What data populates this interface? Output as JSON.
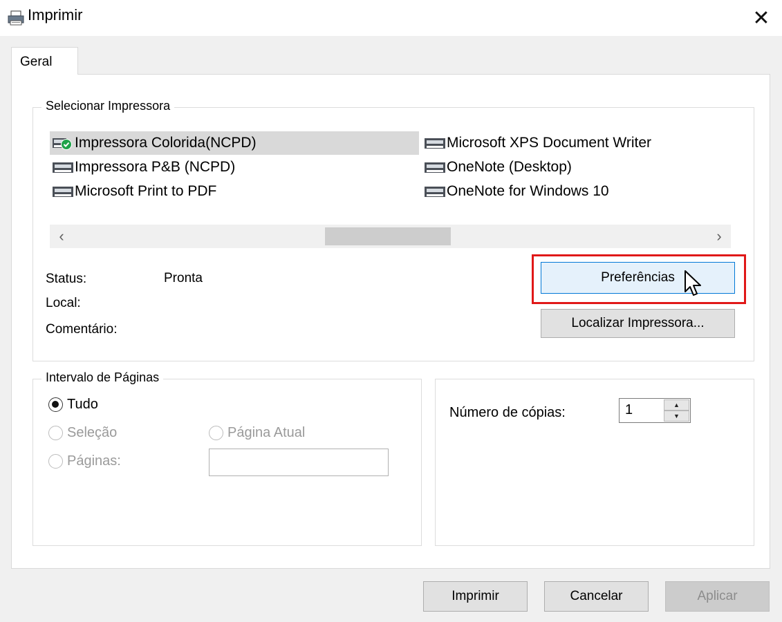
{
  "window": {
    "title": "Imprimir",
    "close_glyph": "✕"
  },
  "tabs": [
    {
      "label": "Geral"
    }
  ],
  "select_printer": {
    "legend": "Selecionar Impressora",
    "printers": [
      {
        "label": "Impressora Colorida(NCPD)",
        "selected": true,
        "default": true
      },
      {
        "label": "Impressora P&B (NCPD)"
      },
      {
        "label": "Microsoft Print to PDF"
      },
      {
        "label": "Microsoft XPS Document Writer"
      },
      {
        "label": "OneNote (Desktop)"
      },
      {
        "label": "OneNote for Windows 10"
      }
    ],
    "scroll_left": "‹",
    "scroll_right": "›",
    "status_label": "Status:",
    "status_value": "Pronta",
    "local_label": "Local:",
    "comment_label": "Comentário:",
    "preferences_button": "Preferências",
    "find_printer_button": "Localizar Impressora..."
  },
  "page_range": {
    "legend": "Intervalo de Páginas",
    "all": "Tudo",
    "selection": "Seleção",
    "current_page": "Página Atual",
    "pages": "Páginas:",
    "selected_option": "Tudo"
  },
  "copies": {
    "label": "Número de cópias:",
    "value": "1"
  },
  "footer": {
    "print": "Imprimir",
    "cancel": "Cancelar",
    "apply": "Aplicar"
  },
  "colors": {
    "highlight": "#e01818",
    "focus_border": "#0078d7",
    "selection_bg": "#d9d9d9",
    "default_check": "#1fa34a"
  },
  "icons": {
    "title": "printer-icon",
    "printer": "printer-icon",
    "default": "default-check-icon",
    "close": "close-icon"
  }
}
